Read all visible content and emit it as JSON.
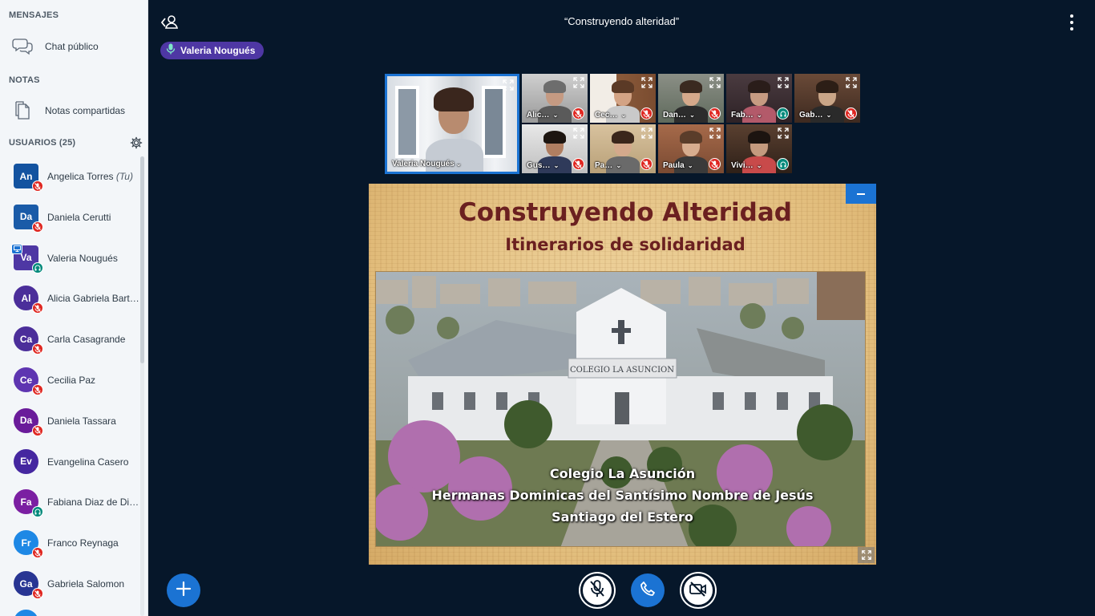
{
  "sidebar": {
    "messages_title": "MENSAJES",
    "public_chat_label": "Chat público",
    "notes_title": "NOTAS",
    "shared_notes_label": "Notas compartidas",
    "users_title": "USUARIOS (25)",
    "users": [
      {
        "initials": "An",
        "name": "Angelica Torres",
        "you": "(Tu)",
        "color": "#1353a0",
        "status": "muted",
        "moderator": true
      },
      {
        "initials": "Da",
        "name": "Daniela Cerutti",
        "color": "#1a5ba8",
        "status": "muted",
        "moderator": true
      },
      {
        "initials": "Va",
        "name": "Valeria Nougués",
        "color": "#4e37a4",
        "status": "listen",
        "moderator": true,
        "presenter": true
      },
      {
        "initials": "Al",
        "name": "Alicia Gabriela Bart…",
        "color": "#4b2e9a",
        "status": "muted"
      },
      {
        "initials": "Ca",
        "name": "Carla Casagrande",
        "color": "#4b2e9a",
        "status": "muted"
      },
      {
        "initials": "Ce",
        "name": "Cecilia Paz",
        "color": "#5e35b1",
        "status": "muted"
      },
      {
        "initials": "Da",
        "name": "Daniela Tassara",
        "color": "#6a1b9a",
        "status": "muted"
      },
      {
        "initials": "Ev",
        "name": "Evangelina Casero",
        "color": "#4527a0",
        "status": "none"
      },
      {
        "initials": "Fa",
        "name": "Fabiana Diaz de Din…",
        "color": "#7b1fa2",
        "status": "listen"
      },
      {
        "initials": "Fr",
        "name": "Franco Reynaga",
        "color": "#1e88e5",
        "status": "muted"
      },
      {
        "initials": "Ga",
        "name": "Gabriela Salomon",
        "color": "#283593",
        "status": "muted"
      }
    ]
  },
  "header": {
    "meeting_title": "“Construyendo alteridad”",
    "talking_indicator": "Valeria Nougués"
  },
  "videos": {
    "main": {
      "name": "Valeria Nougués"
    },
    "tiles": [
      {
        "name": "Alic…",
        "status": "muted"
      },
      {
        "name": "Cec…",
        "status": "muted"
      },
      {
        "name": "Dan…",
        "status": "muted"
      },
      {
        "name": "Fab…",
        "status": "listen"
      },
      {
        "name": "Gab…",
        "status": "muted"
      },
      {
        "name": "Gus…",
        "status": "muted"
      },
      {
        "name": "Pa…",
        "status": "muted"
      },
      {
        "name": "Paula",
        "status": "muted"
      },
      {
        "name": "Vivi…",
        "status": "listen"
      }
    ]
  },
  "presentation": {
    "title": "Construyendo Alteridad",
    "subtitle": "Itinerarios de solidaridad",
    "line1": "Colegio La Asunción",
    "line2": "Hermanas Dominicas del Santísimo Nombre de Jesús",
    "line3": "Santiago del Estero",
    "building_sign": "COLEGIO LA ASUNCION"
  },
  "colors": {
    "background": "#06172a",
    "accent_blue": "#1b73d3",
    "muted_red": "#df2721",
    "listen_teal": "#00897b",
    "talker_purple": "#4e37a4",
    "slide_title": "#6b2020"
  },
  "icons": {
    "chat": "chat-bubbles-icon",
    "notes": "notes-document-icon",
    "settings": "gear-icon",
    "back": "user-back-icon",
    "more": "kebab-menu-icon",
    "plus": "plus-icon",
    "mute": "mic-muted-icon",
    "phone": "phone-icon",
    "camera": "camera-off-icon"
  }
}
